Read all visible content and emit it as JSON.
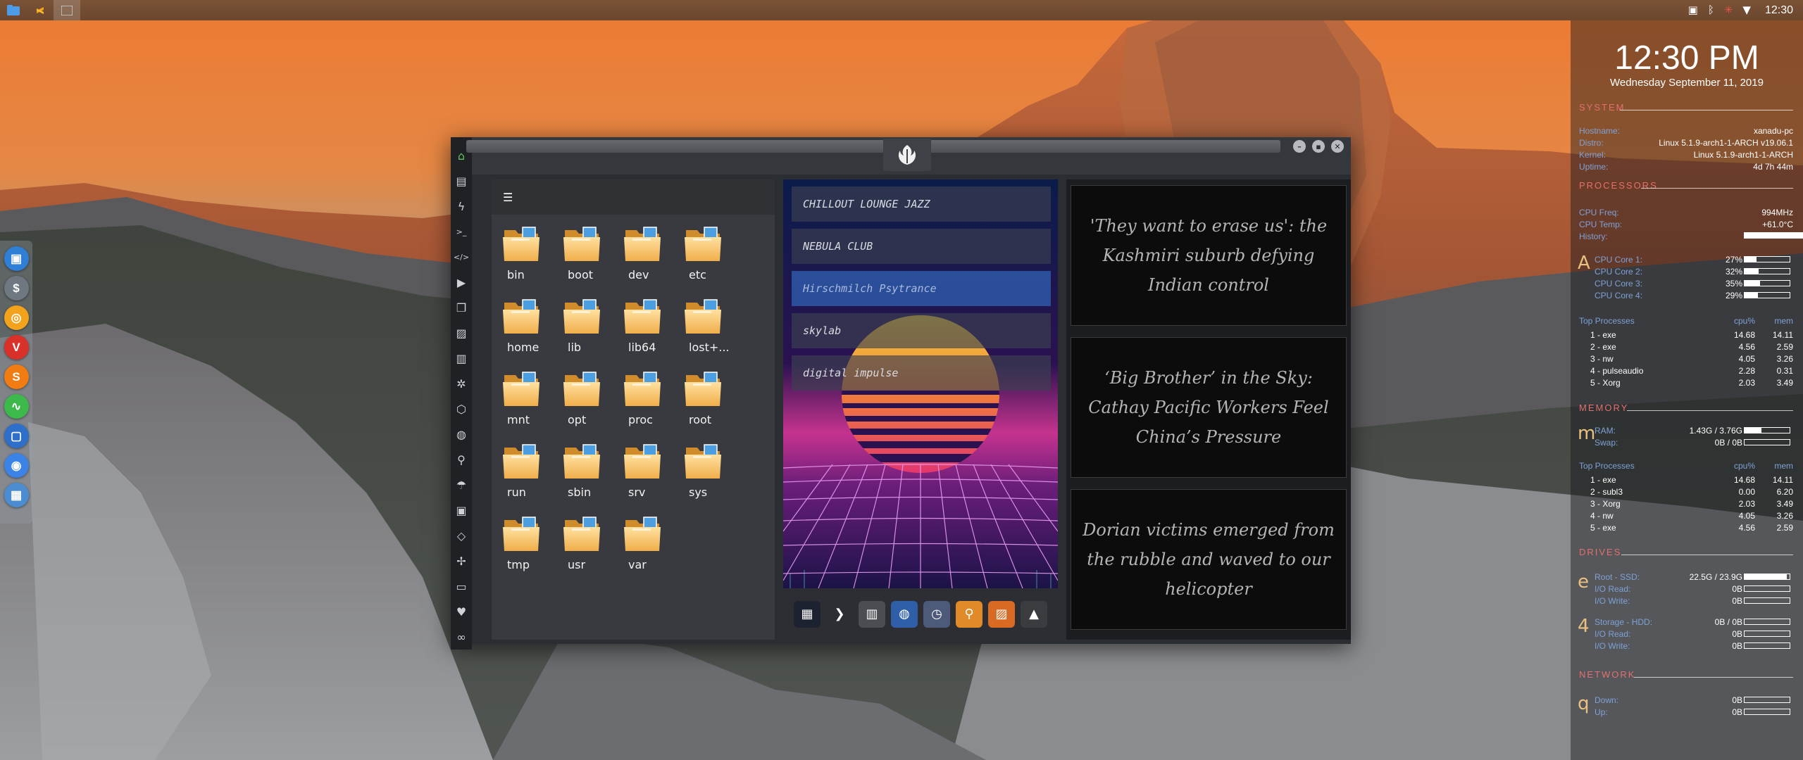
{
  "top_panel": {
    "launchers": [
      "file-manager-icon",
      "sublime-icon",
      "app-icon"
    ],
    "tray_icons": [
      "photo-icon",
      "bluetooth-icon",
      "red-asterisk-icon",
      "wifi-icon"
    ],
    "clock": "12:30"
  },
  "dock": {
    "items": [
      {
        "icon": "folder-icon",
        "color": "#2f7fd6",
        "glyph": "▣"
      },
      {
        "icon": "money-icon",
        "color": "#6f7780",
        "glyph": "$"
      },
      {
        "icon": "ubuntu-icon",
        "color": "#f2a21b",
        "glyph": "◎"
      },
      {
        "icon": "vivaldi-icon",
        "color": "#d9312a",
        "glyph": "V"
      },
      {
        "icon": "sublime-icon",
        "color": "#f07c12",
        "glyph": "S"
      },
      {
        "icon": "activity-icon",
        "color": "#3db84a",
        "glyph": "∿"
      },
      {
        "icon": "screen-icon",
        "color": "#2d6fc9",
        "glyph": "▢"
      },
      {
        "icon": "chrome-icon",
        "color": "#3b83e6",
        "glyph": "◉"
      },
      {
        "icon": "grid-icon",
        "color": "#4c8cd0",
        "glyph": "▦"
      }
    ]
  },
  "window": {
    "sidebar_icons": [
      {
        "name": "home-icon",
        "glyph": "⌂"
      },
      {
        "name": "document-icon",
        "glyph": "▤"
      },
      {
        "name": "lightning-icon",
        "glyph": "ϟ"
      },
      {
        "name": "terminal-icon",
        "glyph": ">_"
      },
      {
        "name": "code-icon",
        "glyph": "</>"
      },
      {
        "name": "play-icon",
        "glyph": "▶"
      },
      {
        "name": "copy-icon",
        "glyph": "❐"
      },
      {
        "name": "image-icon",
        "glyph": "▨"
      },
      {
        "name": "news-icon",
        "glyph": "▥"
      },
      {
        "name": "settings-icon",
        "glyph": "✲"
      },
      {
        "name": "hexagon-icon",
        "glyph": "⬡"
      },
      {
        "name": "globe-icon",
        "glyph": "◍"
      },
      {
        "name": "search-icon",
        "glyph": "⚲"
      },
      {
        "name": "umbrella-icon",
        "glyph": "☂"
      },
      {
        "name": "contact-icon",
        "glyph": "▣"
      },
      {
        "name": "ticket-icon",
        "glyph": "◇"
      },
      {
        "name": "expand-icon",
        "glyph": "✢"
      },
      {
        "name": "youtube-icon",
        "glyph": "▭"
      },
      {
        "name": "heart-icon",
        "glyph": "♥"
      },
      {
        "name": "link-icon",
        "glyph": "∞"
      }
    ],
    "files": {
      "menu_icon": "menu-icon",
      "items": [
        "bin",
        "boot",
        "dev",
        "etc",
        "home",
        "lib",
        "lib64",
        "lost+...",
        "mnt",
        "opt",
        "proc",
        "root",
        "run",
        "sbin",
        "srv",
        "sys",
        "tmp",
        "usr",
        "var"
      ]
    },
    "music": {
      "stations": [
        {
          "label": "CHILLOUT LOUNGE JAZZ",
          "selected": false
        },
        {
          "label": "NEBULA CLUB",
          "selected": false
        },
        {
          "label": "Hirschmilch Psytrance",
          "selected": true
        },
        {
          "label": "skylab",
          "selected": false
        },
        {
          "label": "digital impulse",
          "selected": false
        }
      ],
      "dock_icons": [
        {
          "name": "calculator-icon",
          "color": "#1d2230",
          "glyph": "▦"
        },
        {
          "name": "terminal-arrow-icon",
          "color": "#2c2e33",
          "glyph": "❯"
        },
        {
          "name": "calendar-icon",
          "color": "#4a4d52",
          "glyph": "▥"
        },
        {
          "name": "globe-icon",
          "color": "#2f5fa8",
          "glyph": "◍"
        },
        {
          "name": "clock-icon",
          "color": "#4d5a7a",
          "glyph": "◷"
        },
        {
          "name": "search-icon",
          "color": "#e08a2a",
          "glyph": "⚲"
        },
        {
          "name": "image-viewer-icon",
          "color": "#d86a23",
          "glyph": "▨"
        },
        {
          "name": "acrobat-icon",
          "color": "#3a3c40",
          "glyph": "▲"
        }
      ]
    },
    "news": [
      "'They want to erase us': the Kashmiri suburb defying Indian control",
      "‘Big Brother’ in the Sky: Cathay Pacific Workers Feel China’s Pressure",
      "Dorian victims emerged from the rubble and waved to our helicopter"
    ]
  },
  "conky": {
    "time": "12:30 PM",
    "date": "Wednesday September 11, 2019",
    "system_title": "SYSTEM",
    "system": [
      {
        "key": "Hostname:",
        "value": "xanadu-pc"
      },
      {
        "key": "Distro:",
        "value": "Linux 5.1.9-arch1-1-ARCH v19.06.1"
      },
      {
        "key": "Kernel:",
        "value": "Linux 5.1.9-arch1-1-ARCH"
      },
      {
        "key": "Uptime:",
        "value": "4d 7h 44m"
      }
    ],
    "processors_title": "PROCESSORS",
    "processors": [
      {
        "key": "CPU Freq:",
        "value": "994MHz"
      },
      {
        "key": "CPU Temp:",
        "value": "+61.0°C"
      },
      {
        "key": "History:",
        "value": ""
      }
    ],
    "cpu_glyph": "A",
    "cores": [
      {
        "key": "CPU Core 1:",
        "value": "27%",
        "fill": 0.27
      },
      {
        "key": "CPU Core 2:",
        "value": "32%",
        "fill": 0.32
      },
      {
        "key": "CPU Core 3:",
        "value": "35%",
        "fill": 0.35
      },
      {
        "key": "CPU Core 4:",
        "value": "29%",
        "fill": 0.29
      }
    ],
    "top_header": {
      "title": "Top Processes",
      "c1": "cpu%",
      "c2": "mem"
    },
    "top_cpu": [
      {
        "n": "1 - exe",
        "a": "14.68",
        "b": "14.11"
      },
      {
        "n": "2 - exe",
        "a": "4.56",
        "b": "2.59"
      },
      {
        "n": "3 - nw",
        "a": "4.05",
        "b": "3.26"
      },
      {
        "n": "4 - pulseaudio",
        "a": "2.28",
        "b": "0.31"
      },
      {
        "n": "5 - Xorg",
        "a": "2.03",
        "b": "3.49"
      }
    ],
    "memory_title": "MEMORY",
    "mem_glyph": "m",
    "memory": [
      {
        "key": "RAM:",
        "value": "1.43G / 3.76G",
        "fill": 0.38
      },
      {
        "key": "Swap:",
        "value": "0B / 0B",
        "fill": 0
      }
    ],
    "top_mem_header": {
      "title": "Top Processes",
      "c1": "cpu%",
      "c2": "mem"
    },
    "top_mem": [
      {
        "n": "1 - exe",
        "a": "14.68",
        "b": "14.11"
      },
      {
        "n": "2 - subl3",
        "a": "0.00",
        "b": "6.20"
      },
      {
        "n": "3 - Xorg",
        "a": "2.03",
        "b": "3.49"
      },
      {
        "n": "4 - nw",
        "a": "4.05",
        "b": "3.26"
      },
      {
        "n": "5 - exe",
        "a": "4.56",
        "b": "2.59"
      }
    ],
    "drives_title": "DRIVES",
    "drive1_glyph": "e",
    "drive1": [
      {
        "key": "Root - SSD:",
        "value": "22.5G / 23.9G",
        "fill": 0.94
      },
      {
        "key": "I/O Read:",
        "value": "0B",
        "fill": 0
      },
      {
        "key": "I/O Write:",
        "value": "0B",
        "fill": 0
      }
    ],
    "drive2_glyph": "4",
    "drive2": [
      {
        "key": "Storage - HDD:",
        "value": "0B / 0B",
        "fill": 0
      },
      {
        "key": "I/O Read:",
        "value": "0B",
        "fill": 0
      },
      {
        "key": "I/O Write:",
        "value": "0B",
        "fill": 0
      }
    ],
    "network_title": "NETWORK",
    "net_glyph": "q",
    "network": [
      {
        "key": "Down:",
        "value": "0B",
        "fill": 0
      },
      {
        "key": "Up:",
        "value": "0B",
        "fill": 0
      }
    ],
    "colors": {
      "section": "#e46f6f",
      "key": "#7fa1d6",
      "glyph": "#e9c07f"
    }
  }
}
